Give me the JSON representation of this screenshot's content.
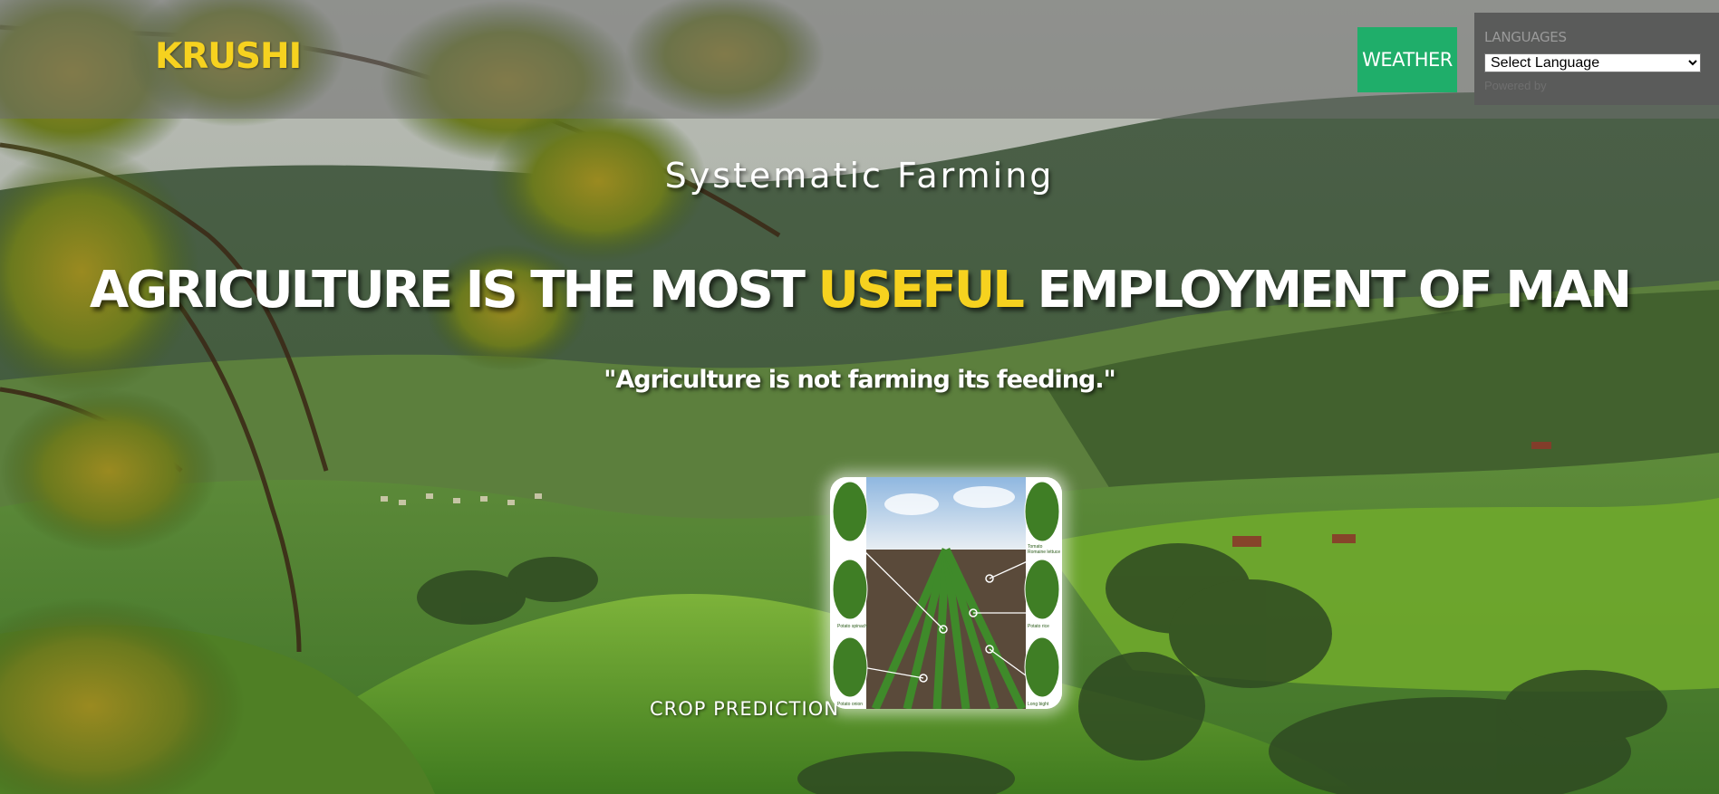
{
  "header": {
    "brand": "KRUSHI",
    "weather_label": "WEATHER",
    "languages_label": "LANGUAGES",
    "language_select_value": "Select Language",
    "powered_by": "Powered by"
  },
  "hero": {
    "subtitle": "Systematic Farming",
    "headline_part1": "AGRICULTURE IS THE MOST ",
    "headline_accent": "USEFUL",
    "headline_part2": " EMPLOYMENT OF MAN",
    "quote": "\"Agriculture is not farming its feeding.\""
  },
  "crop": {
    "label": "CROP PREDICTION",
    "image_tags": [
      "Potato spinach",
      "Potato onion",
      "Tomato",
      "Romaine lettuce",
      "Potato rice",
      "Long bight"
    ]
  },
  "colors": {
    "brand": "#f6d21f",
    "accent": "#f6d21f",
    "weather_button": "#1fae6a",
    "language_panel": "#5a5b5a"
  }
}
